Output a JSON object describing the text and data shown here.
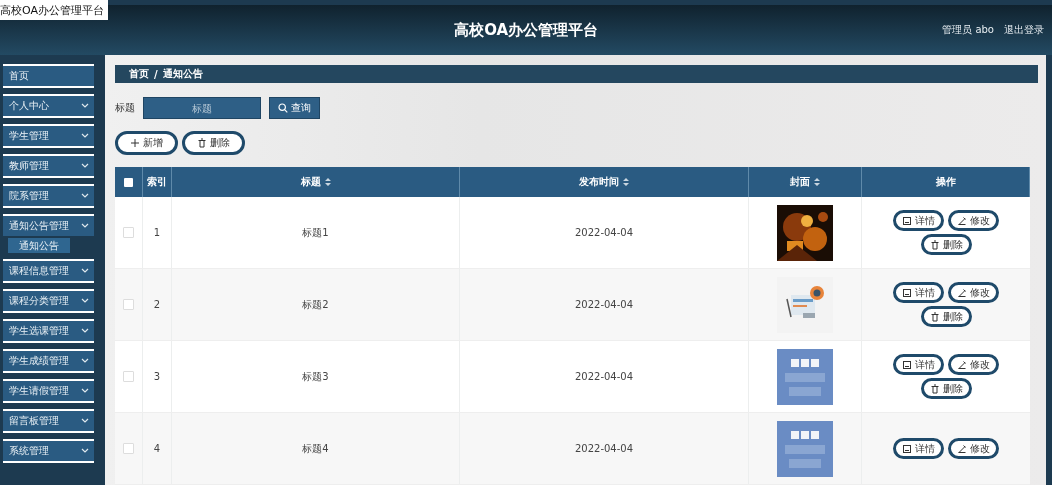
{
  "window": {
    "title": "高校OA办公管理平台"
  },
  "header": {
    "title": "高校OA办公管理平台",
    "user": "管理员 abo",
    "logout": "退出登录"
  },
  "sidebar": {
    "items": [
      {
        "label": "首页",
        "kind": "link",
        "expanded": false
      },
      {
        "label": "个人中心",
        "kind": "group",
        "expanded": false
      },
      {
        "label": "学生管理",
        "kind": "group",
        "expanded": false
      },
      {
        "label": "教师管理",
        "kind": "group",
        "expanded": false
      },
      {
        "label": "院系管理",
        "kind": "group",
        "expanded": false
      },
      {
        "label": "通知公告管理",
        "kind": "group",
        "expanded": true,
        "children": [
          {
            "label": "通知公告",
            "selected": true
          }
        ]
      },
      {
        "label": "课程信息管理",
        "kind": "group",
        "expanded": false
      },
      {
        "label": "课程分类管理",
        "kind": "group",
        "expanded": false
      },
      {
        "label": "学生选课管理",
        "kind": "group",
        "expanded": false
      },
      {
        "label": "学生成绩管理",
        "kind": "group",
        "expanded": false
      },
      {
        "label": "学生请假管理",
        "kind": "group",
        "expanded": false
      },
      {
        "label": "留言板管理",
        "kind": "group",
        "expanded": false
      },
      {
        "label": "系统管理",
        "kind": "group",
        "expanded": false
      }
    ]
  },
  "breadcrumb": [
    "首页",
    "/",
    "通知公告"
  ],
  "search": {
    "label": "标题",
    "placeholder": "标题",
    "button": "查询"
  },
  "actions": [
    {
      "kind": "add",
      "label": "新增"
    },
    {
      "kind": "delete",
      "label": "删除"
    }
  ],
  "table": {
    "all_checked": false,
    "columns": [
      {
        "kind": "check"
      },
      {
        "kind": "text",
        "label": "索引",
        "sortable": false
      },
      {
        "kind": "text",
        "label": "标题",
        "sortable": true
      },
      {
        "kind": "text",
        "label": "发布时间",
        "sortable": true
      },
      {
        "kind": "text",
        "label": "封面",
        "sortable": true
      },
      {
        "kind": "text",
        "label": "操作",
        "sortable": false
      }
    ],
    "rows": [
      {
        "index": "1",
        "title": "标题1",
        "date": "2022-04-04",
        "checked": false,
        "cover": {
          "kind": "picture"
        },
        "buttons": [
          {
            "kind": "detail",
            "label": "详情"
          },
          {
            "kind": "edit",
            "label": "修改"
          },
          {
            "kind": "delete",
            "label": "删除"
          }
        ]
      },
      {
        "index": "2",
        "title": "标题2",
        "date": "2022-04-04",
        "checked": false,
        "cover": {
          "kind": "picture"
        },
        "buttons": [
          {
            "kind": "detail",
            "label": "详情"
          },
          {
            "kind": "edit",
            "label": "修改"
          },
          {
            "kind": "delete",
            "label": "删除"
          }
        ]
      },
      {
        "index": "3",
        "title": "标题3",
        "date": "2022-04-04",
        "checked": false,
        "cover": {
          "kind": "picture"
        },
        "buttons": [
          {
            "kind": "detail",
            "label": "详情"
          },
          {
            "kind": "edit",
            "label": "修改"
          },
          {
            "kind": "delete",
            "label": "删除"
          }
        ]
      },
      {
        "index": "4",
        "title": "标题4",
        "date": "2022-04-04",
        "checked": false,
        "cover": {
          "kind": "picture"
        },
        "buttons": [
          {
            "kind": "detail",
            "label": "详情"
          },
          {
            "kind": "edit",
            "label": "修改"
          }
        ]
      }
    ]
  }
}
